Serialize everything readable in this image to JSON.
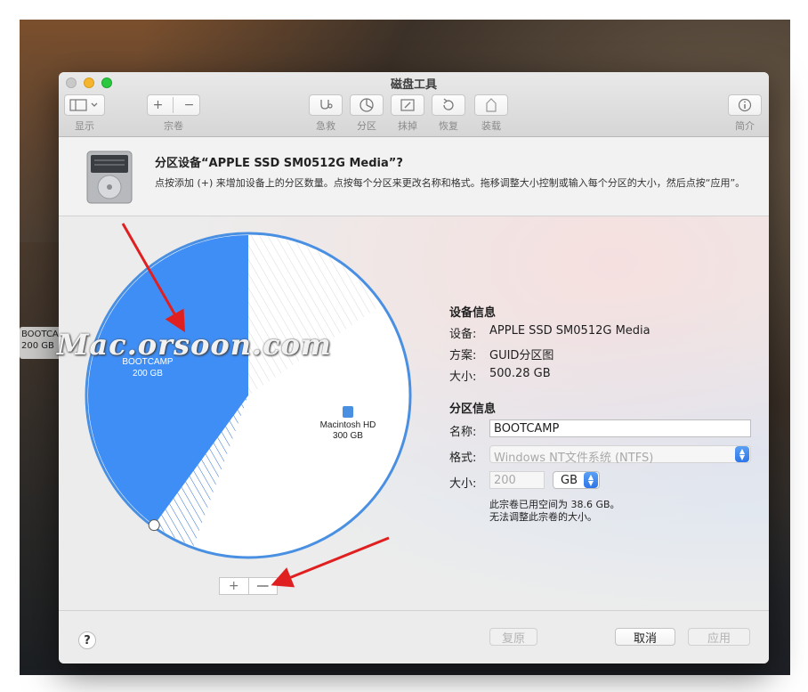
{
  "window": {
    "title": "磁盘工具"
  },
  "toolbar": {
    "view": "显示",
    "volume": "宗卷",
    "first_aid": "急救",
    "partition": "分区",
    "erase": "抹掉",
    "restore": "恢复",
    "mount": "装载",
    "info": "简介"
  },
  "header": {
    "title": "分区设备“APPLE SSD SM0512G Media”?",
    "description": "点按添加 (+) 来增加设备上的分区数量。点按每个分区来更改名称和格式。拖移调整大小控制或输入每个分区的大小，然后点按“应用”。"
  },
  "pie": {
    "bootcamp_label": "BOOTCAMP",
    "bootcamp_size": "200 GB",
    "mac_label": "Macintosh HD",
    "mac_size": "300 GB",
    "bootcamp_fraction": 0.4,
    "colors": {
      "bootcamp": "#3f8ef5",
      "mac": "#ffffff",
      "ring": "#4a90e2"
    }
  },
  "device_info": {
    "heading": "设备信息",
    "device_label": "设备:",
    "device_value": "APPLE SSD SM0512G Media",
    "scheme_label": "方案:",
    "scheme_value": "GUID分区图",
    "size_label": "大小:",
    "size_value": "500.28 GB"
  },
  "partition_info": {
    "heading": "分区信息",
    "name_label": "名称:",
    "name_value": "BOOTCAMP",
    "format_label": "格式:",
    "format_value": "Windows NT文件系统 (NTFS)",
    "size_label": "大小:",
    "size_value": "200",
    "size_unit": "GB",
    "note_line1": "此宗卷已用空间为 38.6 GB。",
    "note_line2": "无法调整此宗卷的大小。"
  },
  "buttons": {
    "help": "?",
    "revert": "复原",
    "cancel": "取消",
    "apply": "应用",
    "add": "+",
    "remove": "—"
  },
  "overlay": {
    "watermark": "Mac.orsoon.com",
    "desktop_label_1": "BOOTCAMP",
    "desktop_label_2": "200 GB"
  }
}
